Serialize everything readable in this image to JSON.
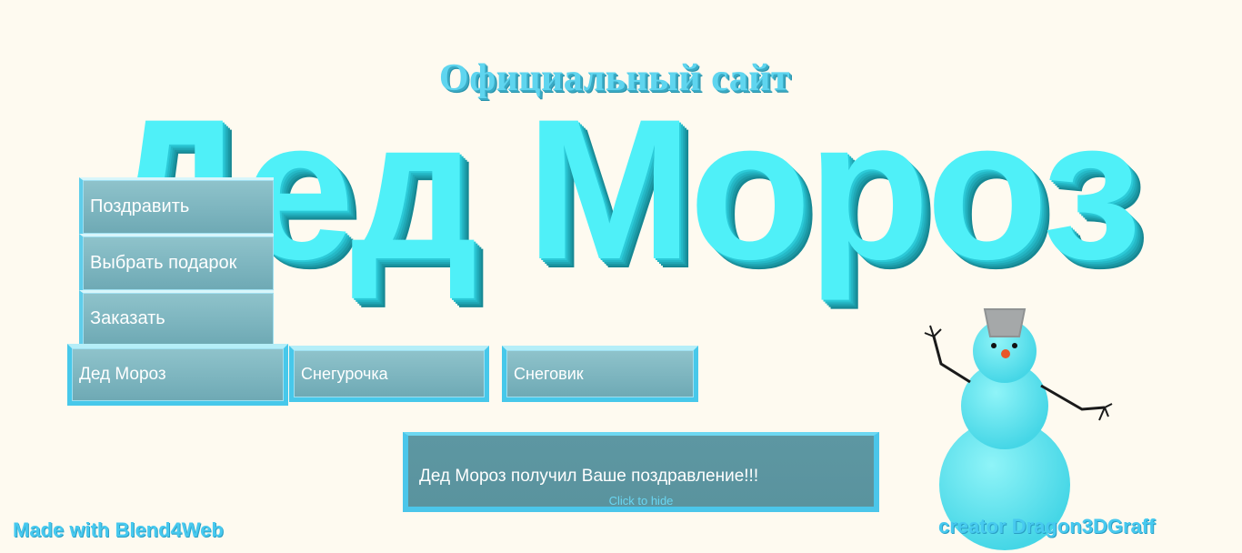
{
  "header": {
    "subtitle": "Официальный сайт",
    "title": "Дед Мороз"
  },
  "menu": {
    "items": [
      {
        "label": "Поздравить"
      },
      {
        "label": "Выбрать подарок"
      },
      {
        "label": "Заказать"
      }
    ]
  },
  "tabs": [
    {
      "label": "Дед Мороз"
    },
    {
      "label": "Снегурочка"
    },
    {
      "label": "Снеговик"
    }
  ],
  "notification": {
    "message": "Дед Мороз получил Ваше поздравление!!!",
    "hide_hint": "Click to hide"
  },
  "footer": {
    "left": "Made with Blend4Web",
    "right": "creator Dragon3DGraff"
  },
  "colors": {
    "background": "#fefaf0",
    "accent": "#4ff0f8",
    "button": "#7db5bf",
    "notification": "#5d97a2"
  },
  "icons": {
    "snowman": "snowman-icon"
  }
}
